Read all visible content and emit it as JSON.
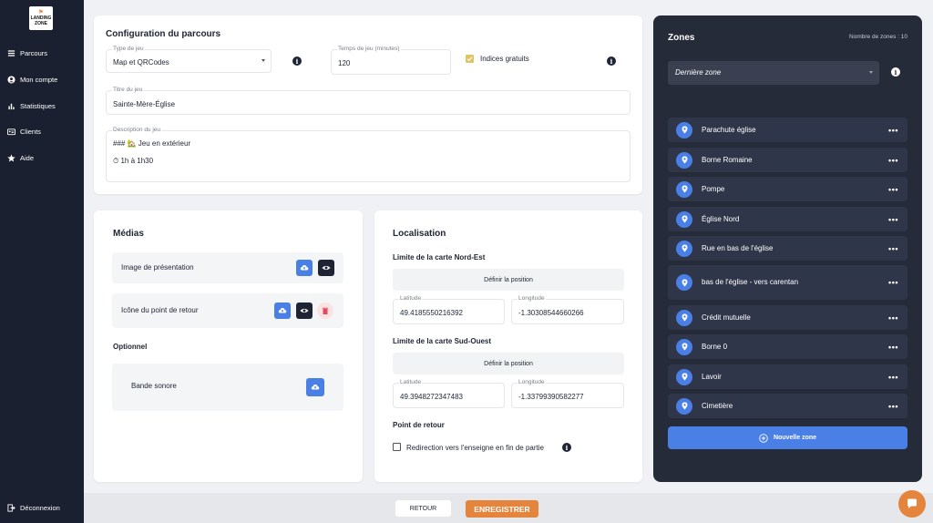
{
  "sidebar": {
    "logo_line1": "LANDING",
    "logo_line2": "ZONE",
    "items": [
      {
        "label": "Parcours",
        "icon": "list-icon"
      },
      {
        "label": "Mon compte",
        "icon": "user-icon"
      },
      {
        "label": "Statistiques",
        "icon": "bar-chart-icon"
      },
      {
        "label": "Clients",
        "icon": "id-card-icon"
      },
      {
        "label": "Aide",
        "icon": "star-icon"
      }
    ],
    "logout": "Déconnexion"
  },
  "config": {
    "title": "Configuration du parcours",
    "game_type_label": "Type de jeu",
    "game_type_value": "Map et QRCodes",
    "time_label": "Temps de jeu (minutes)",
    "time_value": "120",
    "free_hints_label": "Indices gratuits",
    "free_hints_checked": true,
    "game_title_label": "Titre du jeu",
    "game_title_value": "Sainte-Mère-Église",
    "desc_label": "Description du jeu",
    "desc_line1": "### 🏡 Jeu en extérieur",
    "desc_line2": "⏱ 1h à 1h30"
  },
  "media": {
    "title": "Médias",
    "presentation_image": "Image de présentation",
    "return_icon": "Icône du point de retour",
    "optional": "Optionnel",
    "soundtrack": "Bande sonore"
  },
  "location": {
    "title": "Localisation",
    "ne_label": "Limite de la carte Nord-Est",
    "set_position": "Définir la position",
    "lat_label": "Latitude",
    "lng_label": "Longitude",
    "ne_lat": "49.4185550216392",
    "ne_lng": "-1.30308544660266",
    "sw_label": "Limite de la carte Sud-Ouest",
    "sw_lat": "49.3948272347483",
    "sw_lng": "-1.33799390582277",
    "return_point": "Point de retour",
    "redirect_label": "Redirection vers l'enseigne en fin de partie",
    "redirect_checked": false
  },
  "zones": {
    "title": "Zones",
    "count_label": "Nombre de zones : 10",
    "last_zone": "Dernière zone",
    "items": [
      "Parachute église",
      "Borne Romaine",
      "Pompe",
      "Église Nord",
      "Rue en bas de l'église",
      "bas de l'église - vers carentan",
      "Crédit mutuelle",
      "Borne 0",
      "Lavoir",
      "Cimetière"
    ],
    "more": "•••",
    "new_zone": "Nouvelle zone"
  },
  "footer": {
    "back": "RETOUR",
    "save": "ENREGISTRER"
  },
  "colors": {
    "accent": "#4a7fe5",
    "save": "#e5853d",
    "sidebar": "#1a2030",
    "zones_panel": "#252b38"
  }
}
